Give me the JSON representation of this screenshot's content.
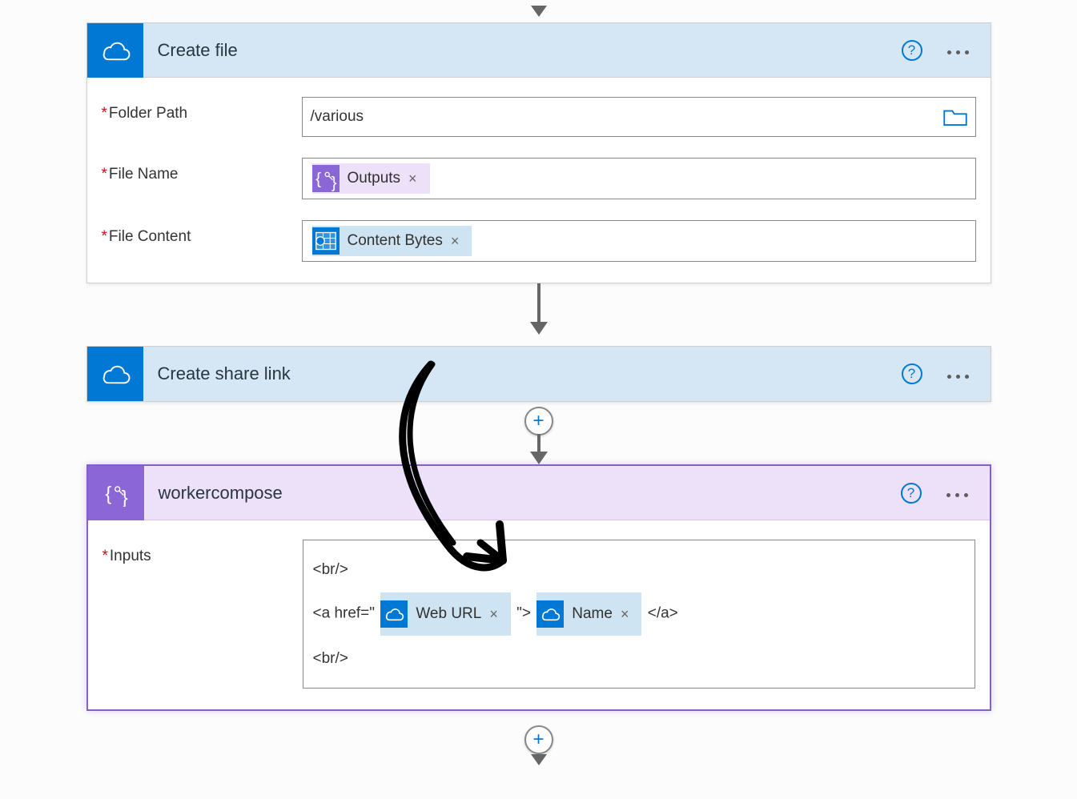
{
  "dangle_visible": true,
  "steps": {
    "create_file": {
      "title": "Create file",
      "fields": {
        "folder_path": {
          "label": "Folder Path",
          "value": "/various"
        },
        "file_name": {
          "label": "File Name",
          "token": {
            "label": "Outputs",
            "kind": "compose"
          }
        },
        "file_content": {
          "label": "File Content",
          "token": {
            "label": "Content Bytes",
            "kind": "outlook"
          }
        }
      }
    },
    "create_share_link": {
      "title": "Create share link"
    },
    "workercompose": {
      "title": "workercompose",
      "inputs_label": "Inputs",
      "segments": {
        "br1": "<br/>",
        "a_open": "<a href=\"",
        "web_url": "Web URL",
        "mid": "\">",
        "name_tok": "Name",
        "a_close": "</a>",
        "br2": "<br/>"
      }
    }
  },
  "glyphs": {
    "help": "?",
    "close": "×",
    "plus": "+"
  }
}
